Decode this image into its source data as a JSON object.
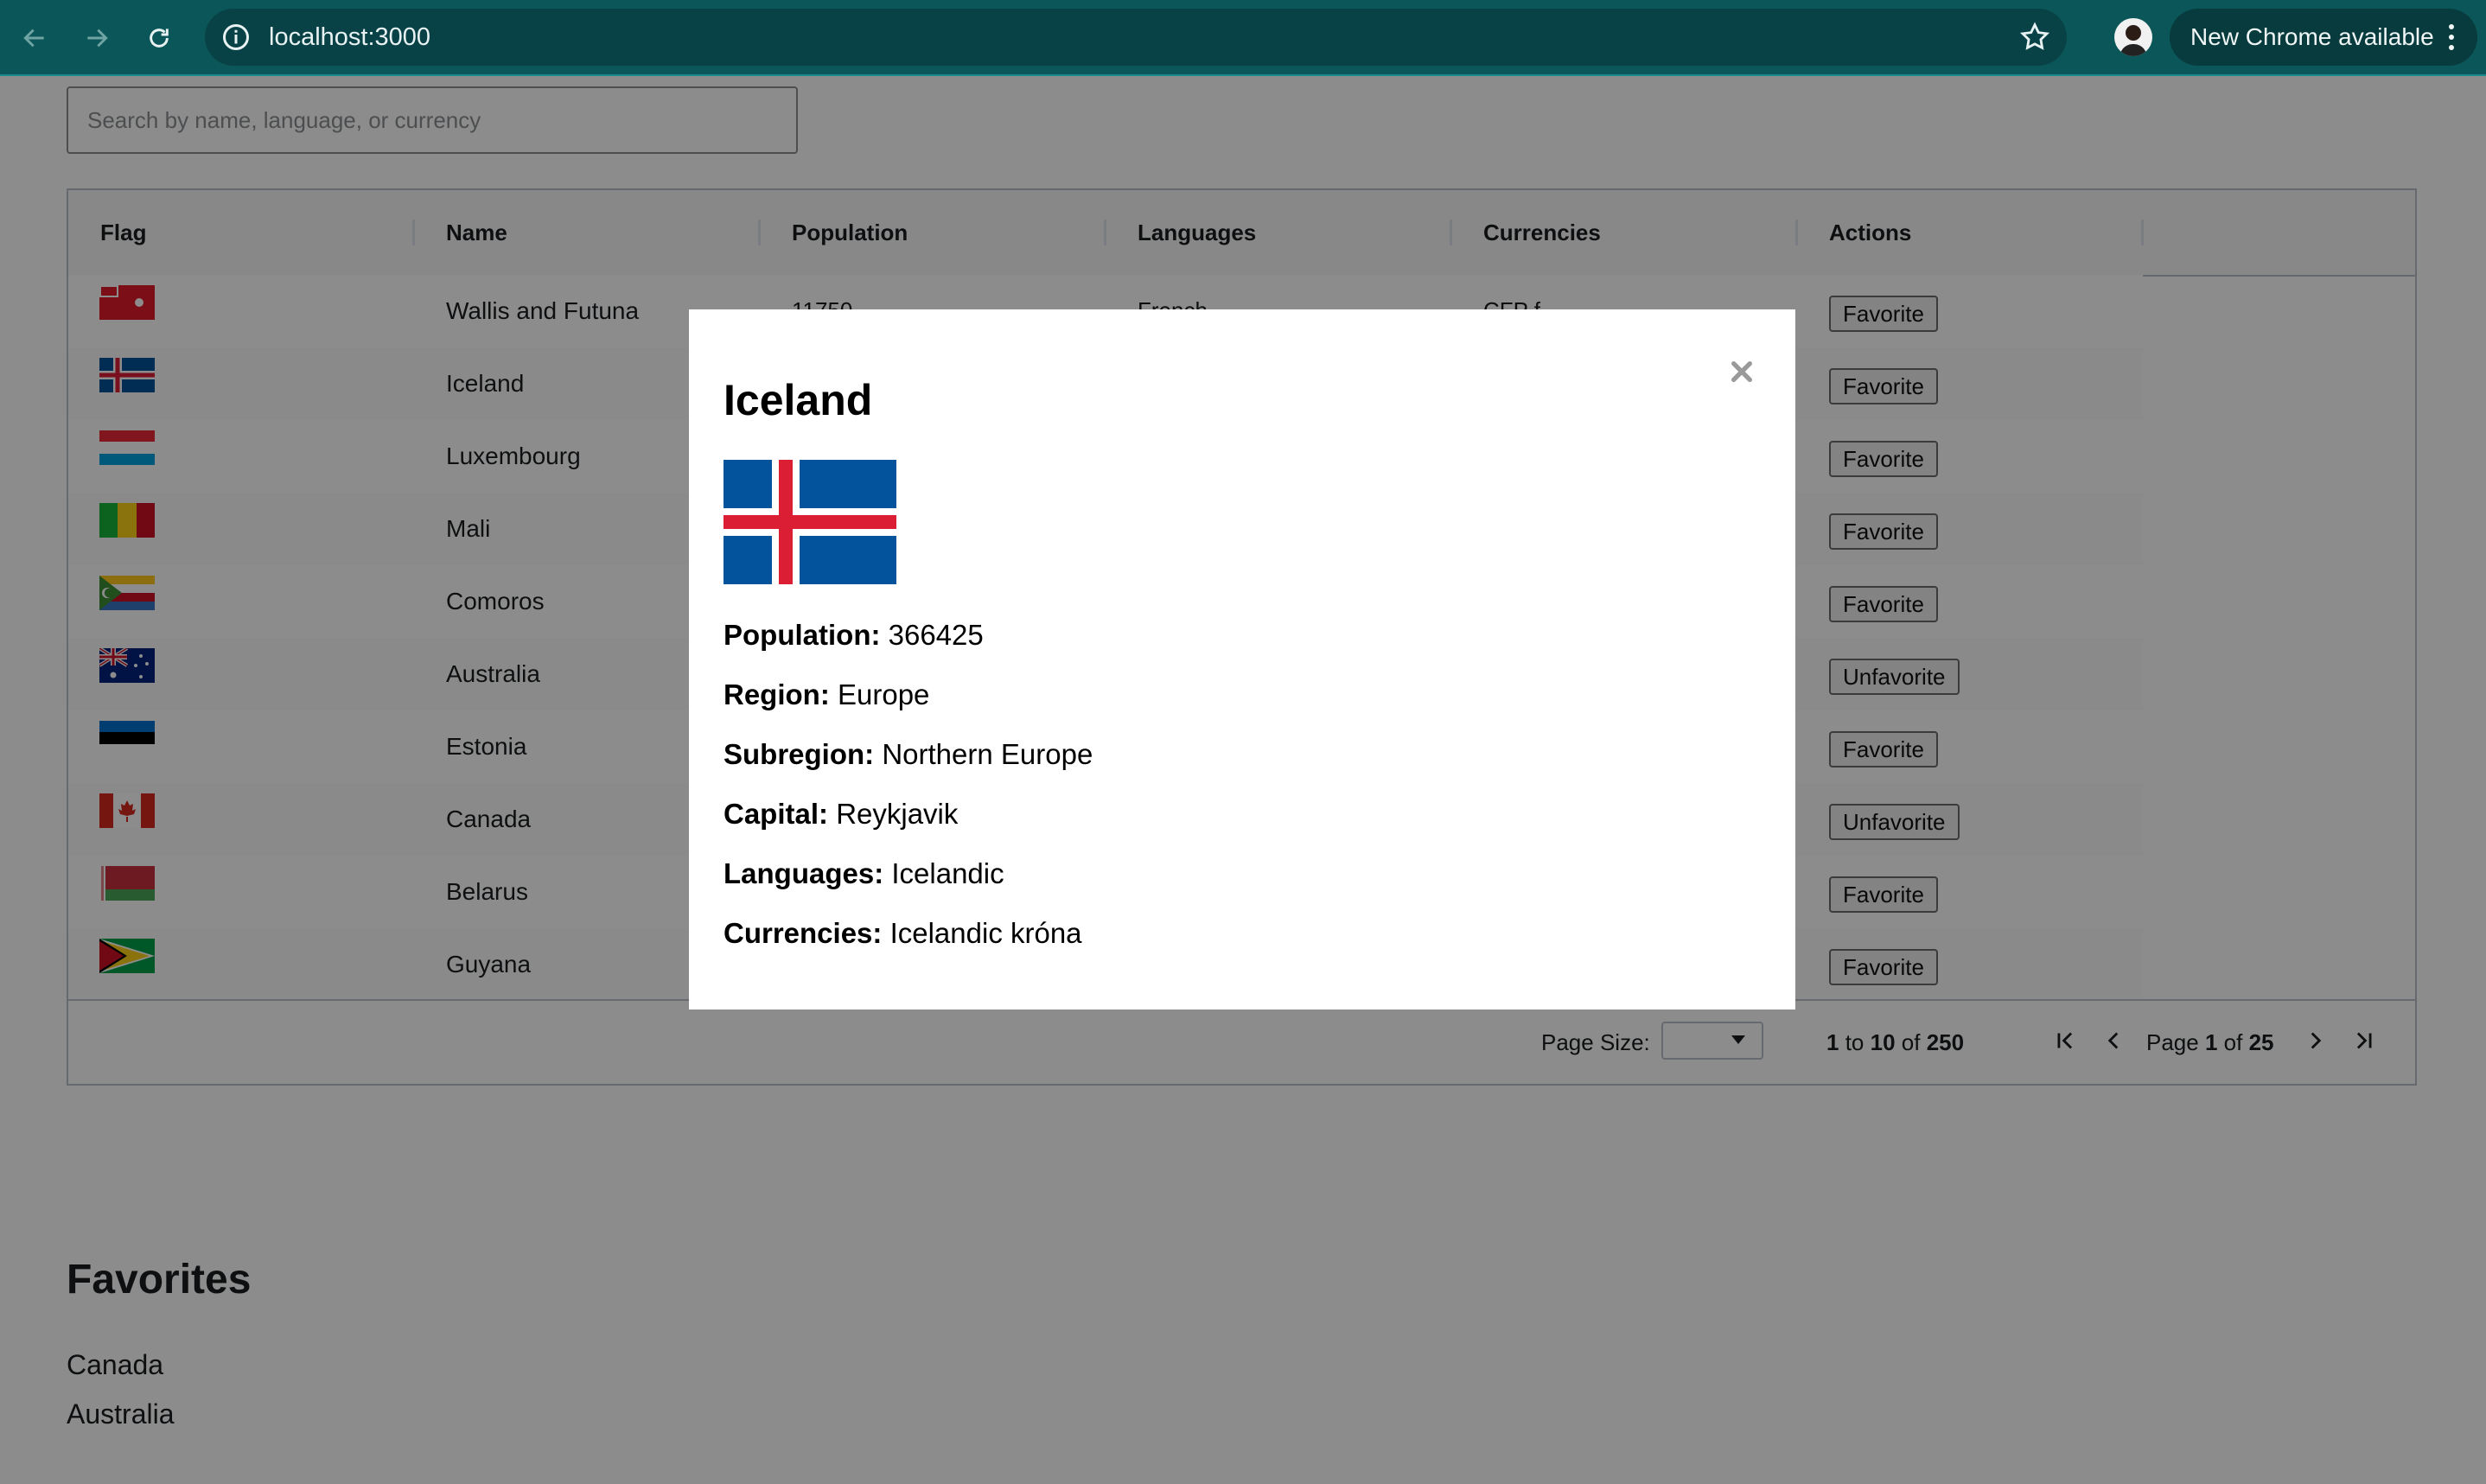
{
  "browser": {
    "url": "localhost:3000",
    "update_label": "New Chrome available"
  },
  "search": {
    "placeholder": "Search by name, language, or currency"
  },
  "grid": {
    "columns": [
      "Flag",
      "Name",
      "Population",
      "Languages",
      "Currencies",
      "Actions"
    ],
    "peek_row": {
      "population": "11750",
      "languages": "French",
      "currencies": "CFP f"
    },
    "rows": [
      {
        "name": "Wallis and Futuna",
        "flag": "wallis-futuna",
        "action": "Favorite"
      },
      {
        "name": "Iceland",
        "flag": "iceland",
        "action": "Favorite"
      },
      {
        "name": "Luxembourg",
        "flag": "luxembourg",
        "action": "Favorite"
      },
      {
        "name": "Mali",
        "flag": "mali",
        "action": "Favorite"
      },
      {
        "name": "Comoros",
        "flag": "comoros",
        "action": "Favorite"
      },
      {
        "name": "Australia",
        "flag": "australia",
        "action": "Unfavorite"
      },
      {
        "name": "Estonia",
        "flag": "estonia",
        "action": "Favorite"
      },
      {
        "name": "Canada",
        "flag": "canada",
        "action": "Unfavorite"
      },
      {
        "name": "Belarus",
        "flag": "belarus",
        "action": "Favorite"
      },
      {
        "name": "Guyana",
        "flag": "guyana",
        "action": "Favorite"
      }
    ],
    "pager": {
      "page_size_label": "Page Size:",
      "from": "1",
      "to_word": "to",
      "to": "10",
      "of_word": "of",
      "total": "250",
      "page_word": "Page",
      "page": "1",
      "pages": "25"
    }
  },
  "favorites": {
    "title": "Favorites",
    "items": [
      "Canada",
      "Australia"
    ]
  },
  "modal": {
    "title": "Iceland",
    "population_label": "Population:",
    "population": "366425",
    "region_label": "Region:",
    "region": "Europe",
    "subregion_label": "Subregion:",
    "subregion": "Northern Europe",
    "capital_label": "Capital:",
    "capital": "Reykjavik",
    "languages_label": "Languages:",
    "languages": "Icelandic",
    "currencies_label": "Currencies:",
    "currencies": "Icelandic króna"
  },
  "colors": {
    "chrome_bar": "#0b5658",
    "overlay": "rgba(0,0,0,0.45)",
    "iceland_blue": "#02529c",
    "iceland_red": "#dc1e35"
  }
}
